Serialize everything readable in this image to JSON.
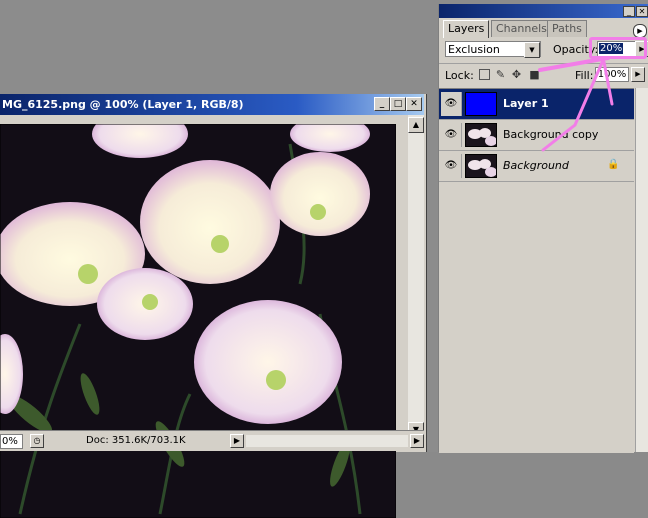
{
  "document": {
    "title": "MG_6125.png @ 100% (Layer 1, RGB/8)",
    "zoom": "0%",
    "doc_size": "Doc: 351.6K/703.1K"
  },
  "panel": {
    "tabs": [
      "Layers",
      "Channels",
      "Paths"
    ],
    "blend_mode": "Exclusion",
    "opacity_label": "Opacity:",
    "opacity_value": "20%",
    "lock_label": "Lock:",
    "fill_label": "Fill:",
    "fill_value": "100%",
    "layers": [
      {
        "name": "Layer 1",
        "selected": true
      },
      {
        "name": "Background copy",
        "selected": false
      },
      {
        "name": "Background",
        "selected": false,
        "locked": true
      }
    ]
  },
  "colors": {
    "title_blue": "#0a246a",
    "layer1_fill": "#0000ff",
    "annotation_pink": "#f27ee8"
  }
}
